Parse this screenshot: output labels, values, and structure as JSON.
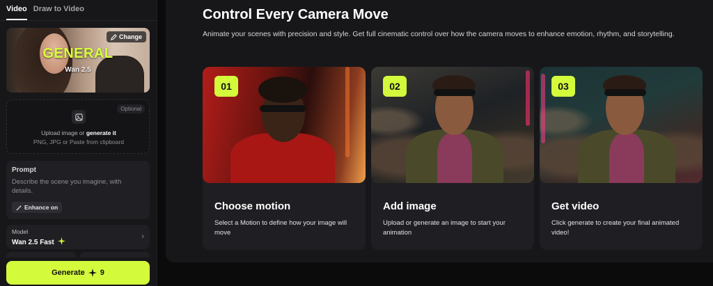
{
  "left_panel": {
    "tabs": [
      {
        "label": "Video",
        "active": true
      },
      {
        "label": "Draw to Video",
        "active": false
      }
    ],
    "hero": {
      "title": "GENERAL",
      "subtitle": "Wan 2.5",
      "change_label": "Change"
    },
    "upload": {
      "optional_label": "Optional",
      "line1_prefix": "Upload image or ",
      "line1_link": "generate it",
      "line2": "PNG, JPG or Paste from clipboard"
    },
    "prompt": {
      "title": "Prompt",
      "placeholder": "Describe the scene you imagine, with details.",
      "enhance_label": "Enhance on"
    },
    "model": {
      "label": "Model",
      "value": "Wan 2.5 Fast"
    },
    "generate": {
      "label": "Generate",
      "cost": "9"
    }
  },
  "main": {
    "title": "Control Every Camera Move",
    "lead": "Animate your scenes with precision and style. Get full cinematic control over how the camera moves to enhance emotion, rhythm, and storytelling.",
    "cards": [
      {
        "number": "01",
        "title": "Choose motion",
        "desc": "Select a Motion to define how your image will move"
      },
      {
        "number": "02",
        "title": "Add image",
        "desc": "Upload or generate an image to start your animation"
      },
      {
        "number": "03",
        "title": "Get video",
        "desc": "Click generate to create your final animated video!"
      }
    ]
  },
  "colors": {
    "accent": "#d4fa3c",
    "panel": "#17171a",
    "card": "#1f1f23"
  },
  "icons": [
    "pencil-icon",
    "image-icon",
    "magic-wand-icon",
    "sparkle-icon",
    "chevron-right-icon"
  ]
}
